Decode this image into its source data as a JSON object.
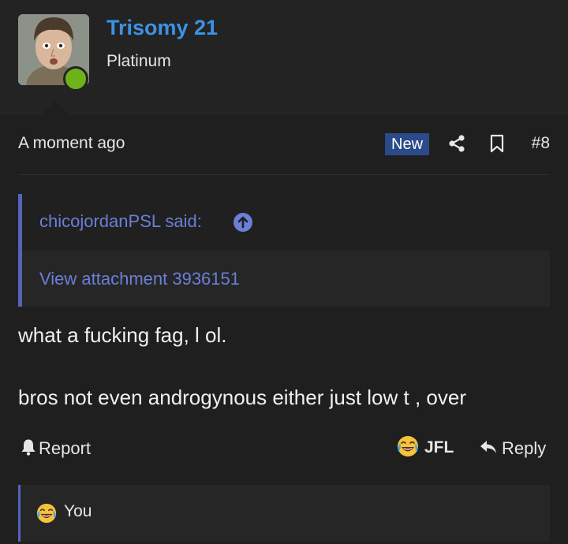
{
  "user": {
    "name": "Trisomy 21",
    "title": "Platinum",
    "online": true
  },
  "post": {
    "timestamp": "A moment ago",
    "badge": "New",
    "number": "#8",
    "quote": {
      "author": "chicojordanPSL said:",
      "attachment": "View attachment 3936151"
    },
    "message_line1": "what a fucking fag, l ol.",
    "message_line2": "bros not even androgynous either just low t , over"
  },
  "actions": {
    "report_label": "Report",
    "reaction_label": "JFL",
    "reply_label": "Reply"
  },
  "reactions": {
    "reactor": "You"
  },
  "icons": {
    "share": "share-icon",
    "bookmark": "bookmark-icon",
    "quote_jump": "arrow-up-circle-icon",
    "report": "bell-icon",
    "reaction": "laughing-crying-emoji-icon",
    "reply": "reply-arrow-icon"
  },
  "colors": {
    "username": "#3b93e6",
    "badge_bg": "#2a4a8a",
    "quote_accent": "#5564b8",
    "quote_text": "#6b7fd7",
    "online": "#6fb21a"
  }
}
